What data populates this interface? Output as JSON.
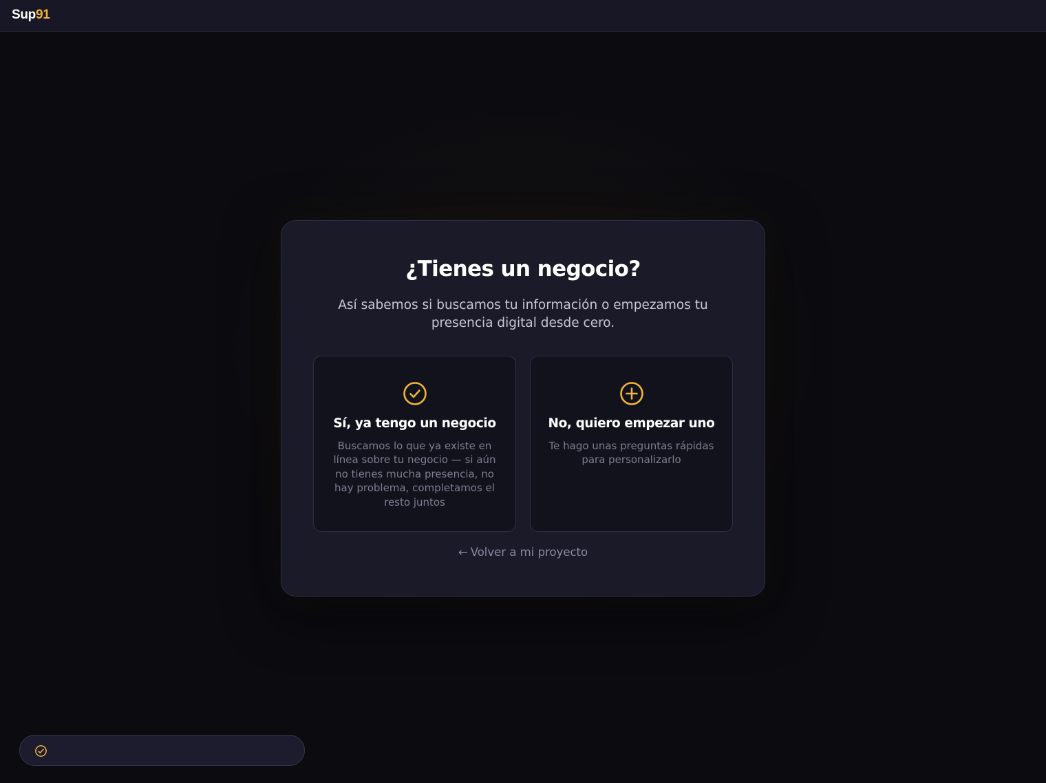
{
  "header": {
    "logo_part1": "Sup",
    "logo_part2": "91"
  },
  "modal": {
    "title": "¿Tienes un negocio?",
    "subtitle": "Así sabemos si buscamos tu información o empezamos tu presencia digital desde cero.",
    "options": [
      {
        "icon": "check-circle-icon",
        "title": "Sí, ya tengo un negocio",
        "description": "Buscamos lo que ya existe en línea sobre tu negocio — si aún no tienes mucha presencia, no hay problema, completamos el resto juntos"
      },
      {
        "icon": "plus-circle-icon",
        "title": "No, quiero empezar uno",
        "description": "Te hago unas preguntas rápidas para personalizarlo"
      }
    ],
    "back_arrow": "←",
    "back_label": "Volver a mi proyecto"
  },
  "toast": {
    "icon": "check-circle-icon",
    "text": ""
  },
  "colors": {
    "accent": "#f0b43a",
    "background": "#0b0b10",
    "panel": "#1a1a29",
    "card": "#12121c"
  }
}
